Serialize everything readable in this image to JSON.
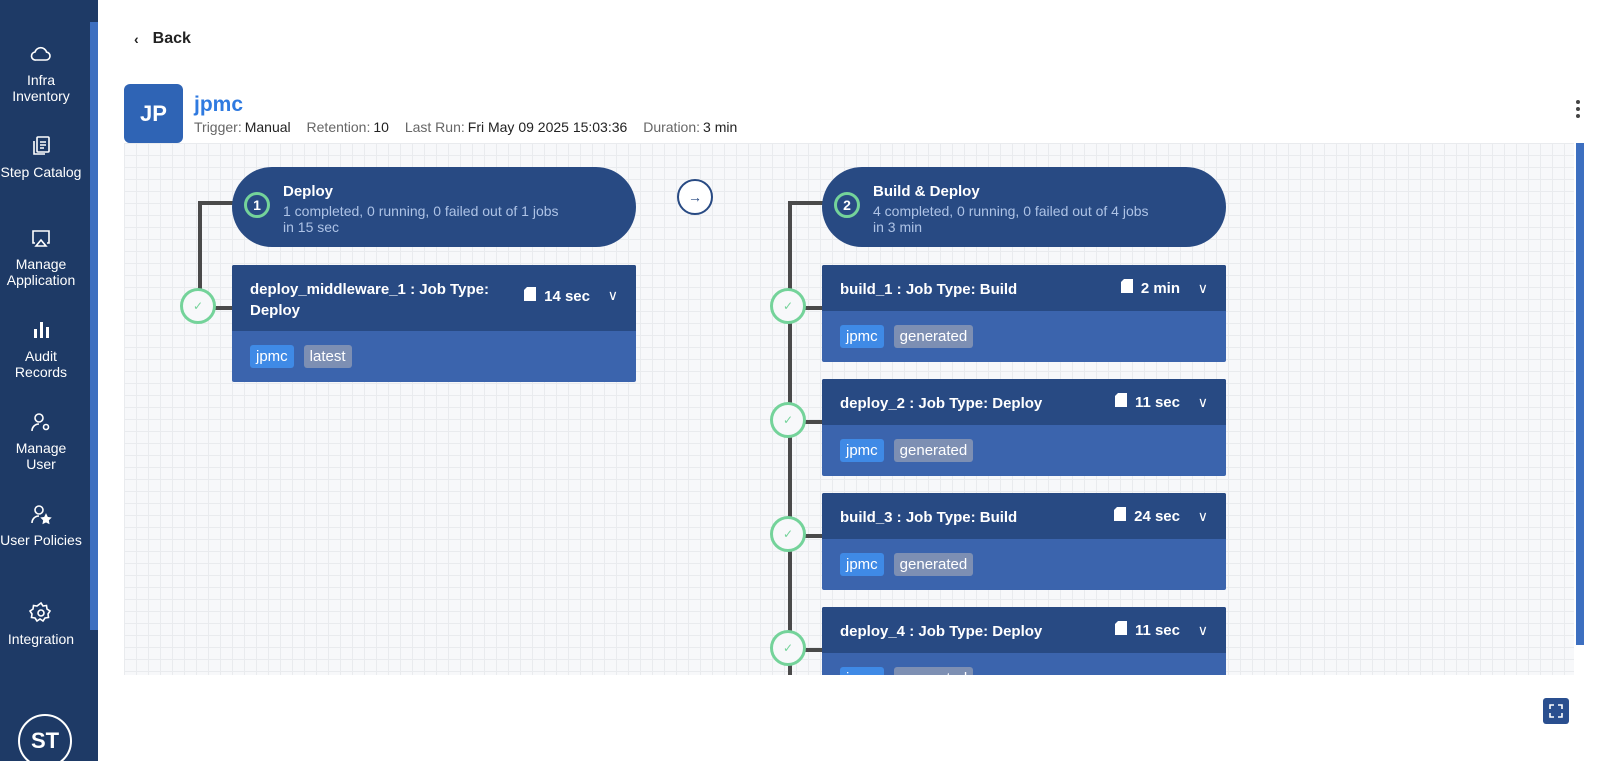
{
  "sidebar": {
    "items": [
      {
        "label": "Infra Inventory",
        "icon": "cloud-icon"
      },
      {
        "label": "Step Catalog",
        "icon": "copy-icon"
      },
      {
        "label": "Manage Application",
        "icon": "airplay-icon"
      },
      {
        "label": "Audit Records",
        "icon": "bar-chart-icon"
      },
      {
        "label": "Manage User",
        "icon": "user-gear-icon"
      },
      {
        "label": "User Policies",
        "icon": "user-star-icon"
      },
      {
        "label": "Integration",
        "icon": "gear-icon"
      }
    ],
    "user_initials": "ST"
  },
  "header": {
    "back_label": "Back",
    "project_initials": "JP",
    "project_name": "jpmc",
    "meta": {
      "trigger_label": "Trigger:",
      "trigger": "Manual",
      "retention_label": "Retention:",
      "retention": "10",
      "last_run_label": "Last Run:",
      "last_run": "Fri May 09 2025 15:03:36",
      "duration_label": "Duration:",
      "duration": "3 min"
    }
  },
  "stages": [
    {
      "number": "1",
      "name": "Deploy",
      "desc": "1 completed, 0 running, 0 failed out of 1 jobs in 15 sec",
      "jobs": [
        {
          "title": "deploy_middleware_1 : Job Type: Deploy",
          "duration": "14 sec",
          "tags": [
            "jpmc",
            "latest"
          ]
        }
      ]
    },
    {
      "number": "2",
      "name": "Build & Deploy",
      "desc": "4 completed, 0 running, 0 failed out of 4 jobs in 3 min",
      "jobs": [
        {
          "title": "build_1 : Job Type: Build",
          "duration": "2 min",
          "tags": [
            "jpmc",
            "generated"
          ]
        },
        {
          "title": "deploy_2 : Job Type: Deploy",
          "duration": "11 sec",
          "tags": [
            "jpmc",
            "generated"
          ]
        },
        {
          "title": "build_3 : Job Type: Build",
          "duration": "24 sec",
          "tags": [
            "jpmc",
            "generated"
          ]
        },
        {
          "title": "deploy_4 : Job Type: Deploy",
          "duration": "11 sec",
          "tags": [
            "jpmc",
            "generated"
          ]
        }
      ]
    }
  ]
}
